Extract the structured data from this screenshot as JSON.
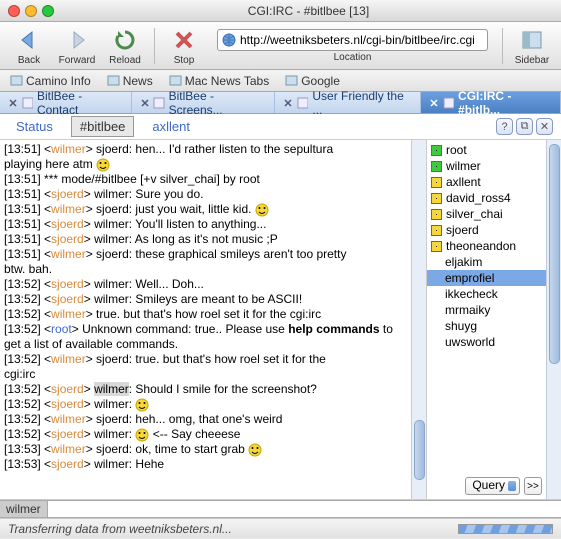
{
  "window": {
    "title": "CGI:IRC - #bitlbee [13]"
  },
  "toolbar": {
    "back": "Back",
    "forward": "Forward",
    "reload": "Reload",
    "stop": "Stop",
    "location_label": "Location",
    "sidebar": "Sidebar",
    "url": "http://weetniksbeters.nl/cgi-bin/bitlbee/irc.cgi"
  },
  "bookmarks": [
    {
      "label": "Camino Info"
    },
    {
      "label": "News"
    },
    {
      "label": "Mac News Tabs"
    },
    {
      "label": "Google"
    }
  ],
  "tabs": [
    {
      "label": "BitlBee - Contact"
    },
    {
      "label": "BitlBee - Screens..."
    },
    {
      "label": "User Friendly the ..."
    },
    {
      "label": "CGI:IRC - #bitlb...",
      "active": true
    }
  ],
  "subtabs": {
    "status": "Status",
    "channel": "#bitlbee",
    "pm": "axllent"
  },
  "helpbtns": [
    "?",
    "⧉",
    "✕"
  ],
  "chat": [
    {
      "ts": "[13:51]",
      "nick": "wilmer",
      "text": "sjoerd: hen... I'd rather listen to the sepultura"
    },
    {
      "cont": true,
      "text": "playing here atm ",
      "smile": true
    },
    {
      "ts": "[13:51]",
      "raw": "*** mode/#bitlbee [+v silver_chai] by root"
    },
    {
      "ts": "[13:51]",
      "nick": "sjoerd",
      "text": "wilmer: Sure you do."
    },
    {
      "ts": "[13:51]",
      "nick": "wilmer",
      "text": "sjoerd: just you wait, little kid. ",
      "smile": true
    },
    {
      "ts": "[13:51]",
      "nick": "sjoerd",
      "text": "wilmer: You'll listen to anything..."
    },
    {
      "ts": "[13:51]",
      "nick": "sjoerd",
      "text": "wilmer: As long as it's not music ;P"
    },
    {
      "ts": "[13:51]",
      "nick": "wilmer",
      "text": "sjoerd: these graphical smileys aren't too pretty"
    },
    {
      "cont": true,
      "text": "btw. bah."
    },
    {
      "ts": "[13:52]",
      "nick": "sjoerd",
      "text": "wilmer: Well... Doh..."
    },
    {
      "ts": "[13:52]",
      "nick": "sjoerd",
      "text": "wilmer: Smileys are meant to be ASCII!"
    },
    {
      "ts": "[13:52]",
      "nick": "wilmer",
      "text": "true. but that's how roel set it for the cgi:irc"
    },
    {
      "ts": "[13:52]",
      "nick_b": "root",
      "html": "Unknown command: true.. Please use <b>help commands</b> to get a list of available commands."
    },
    {
      "ts": "[13:52]",
      "nick": "wilmer",
      "text": "sjoerd: true. but that's how roel set it for the"
    },
    {
      "cont": true,
      "text": "cgi:irc"
    },
    {
      "ts": "[13:52]",
      "nick": "sjoerd",
      "hl": "wilmer",
      "text": ": Should I smile for the screenshot?"
    },
    {
      "ts": "[13:52]",
      "nick": "sjoerd",
      "text": "wilmer: ",
      "smile": true
    },
    {
      "ts": "[13:52]",
      "nick": "wilmer",
      "text": "sjoerd: heh... omg, that one's weird"
    },
    {
      "ts": "[13:52]",
      "nick": "sjoerd",
      "text": "wilmer: ",
      "smile": true,
      "after": " <-- Say cheeese"
    },
    {
      "ts": "[13:53]",
      "nick": "wilmer",
      "text": "sjoerd: ok, time to start  grab ",
      "smile": true
    },
    {
      "ts": "[13:53]",
      "nick": "sjoerd",
      "text": "wilmer: Hehe"
    }
  ],
  "users": {
    "ops": [
      {
        "name": "root",
        "c": "g"
      },
      {
        "name": "wilmer",
        "c": "g"
      },
      {
        "name": "axllent",
        "c": "y"
      },
      {
        "name": "david_ross4",
        "c": "y"
      },
      {
        "name": "silver_chai",
        "c": "y"
      },
      {
        "name": "sjoerd",
        "c": "y"
      },
      {
        "name": "theoneandon",
        "c": "y"
      }
    ],
    "regulars": [
      {
        "name": "eljakim"
      },
      {
        "name": "emprofiel",
        "sel": true
      },
      {
        "name": "ikkecheck"
      },
      {
        "name": "mrmaiky"
      },
      {
        "name": "shuyg"
      },
      {
        "name": "uwsworld"
      }
    ],
    "query_label": "Query",
    "go": ">>"
  },
  "input": {
    "nick": "wilmer",
    "value": ""
  },
  "statusbar": {
    "text": "Transferring data from weetniksbeters.nl..."
  }
}
